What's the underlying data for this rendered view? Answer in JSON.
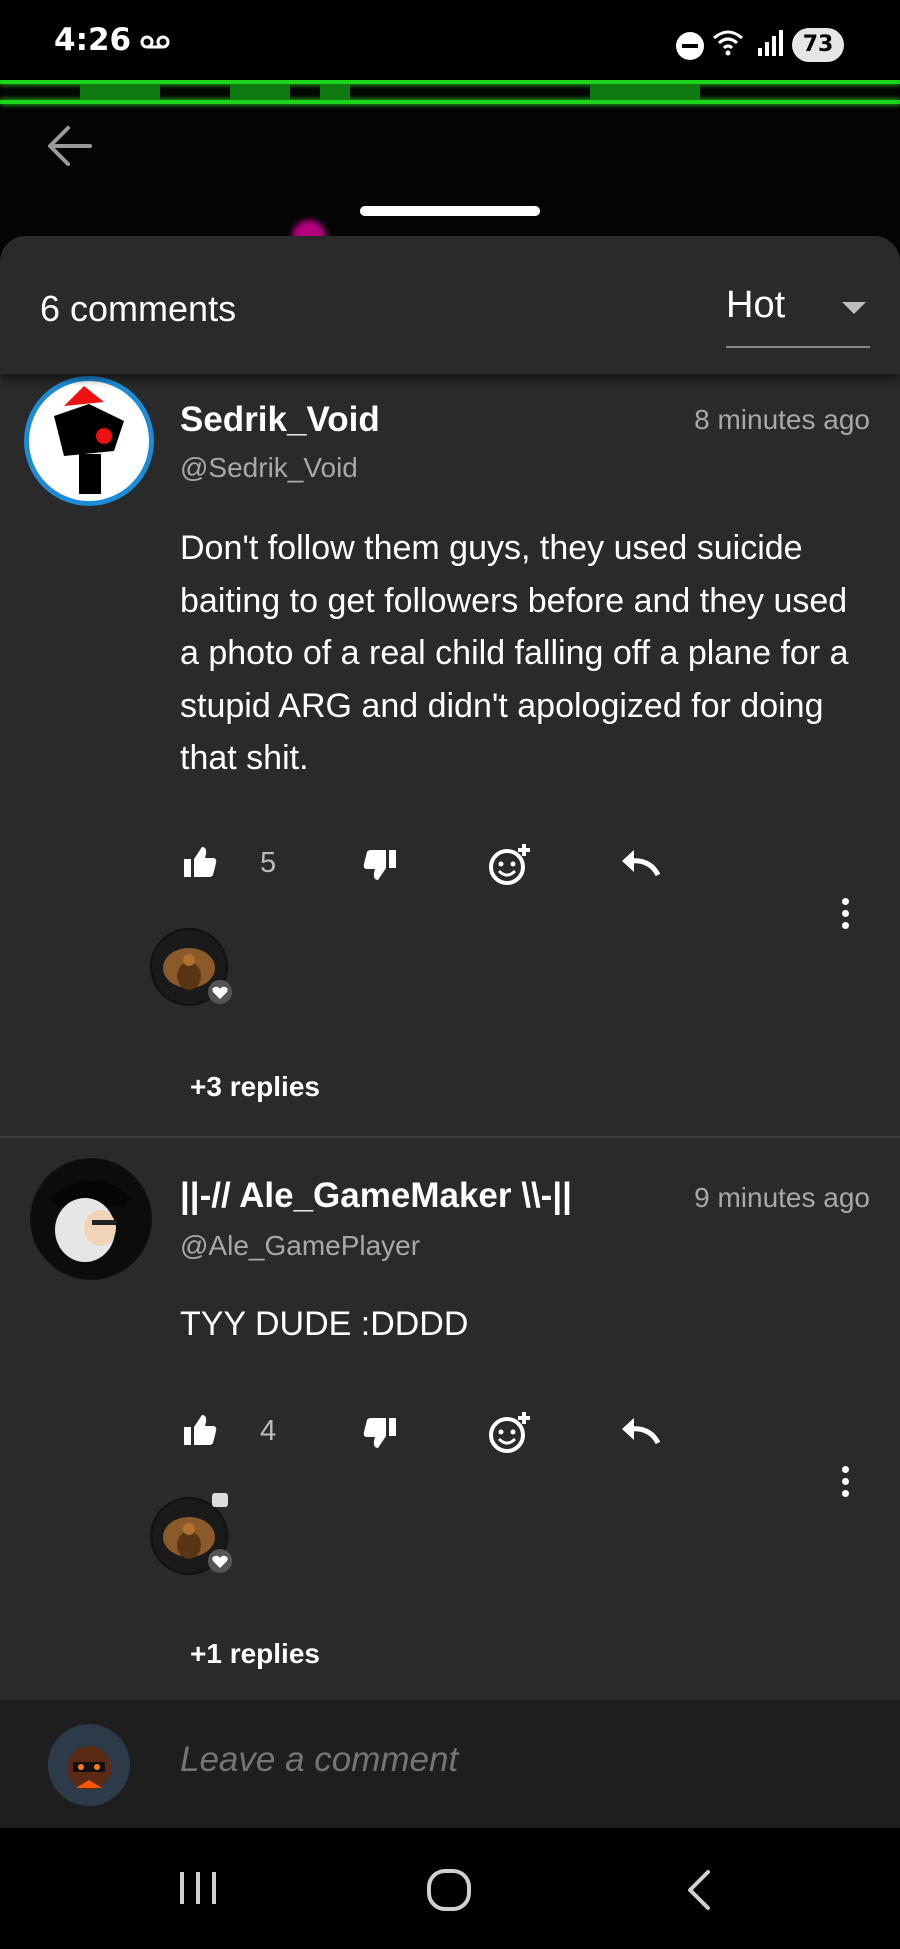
{
  "status_bar": {
    "time": "4:26",
    "battery": "73"
  },
  "sheet": {
    "comment_count": "6 comments",
    "sort": "Hot"
  },
  "comments": [
    {
      "name": "Sedrik_Void",
      "handle": "@Sedrik_Void",
      "time": "8 minutes ago",
      "text": "Don't follow them guys, they used suicide baiting to get followers before and they used a photo of a real child falling off a plane for a stupid ARG and didn't apologized for doing that shit.",
      "likes": "5",
      "replies": "+3 replies"
    },
    {
      "name": "||-// Ale_GameMaker \\\\-||",
      "handle": "@Ale_GamePlayer",
      "time": "9 minutes ago",
      "text": "TYY DUDE :DDDD",
      "likes": "4",
      "replies": "+1 replies"
    }
  ],
  "composer": {
    "placeholder": "Leave a comment"
  },
  "icons": {
    "like": "thumbs-up-icon",
    "dislike": "thumbs-down-icon",
    "react": "add-reaction-icon",
    "reply": "reply-icon",
    "more": "more-vertical-icon"
  },
  "colors": {
    "accent_green": "#1bd41b",
    "sheet_bg": "#2a2a2a"
  }
}
